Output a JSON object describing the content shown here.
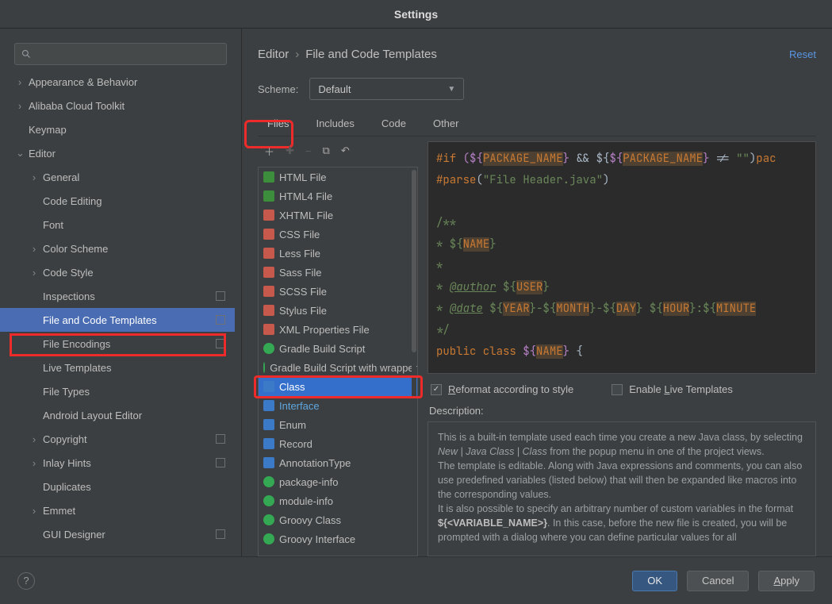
{
  "title": "Settings",
  "search_placeholder": "",
  "tree": [
    {
      "label": "Appearance & Behavior",
      "lvl": 1,
      "exp": true,
      "sel": false,
      "mod": false
    },
    {
      "label": "Alibaba Cloud Toolkit",
      "lvl": 1,
      "exp": true,
      "sel": false,
      "mod": false
    },
    {
      "label": "Keymap",
      "lvl": 1,
      "exp": null,
      "sel": false,
      "mod": false
    },
    {
      "label": "Editor",
      "lvl": 1,
      "exp": "open",
      "sel": false,
      "mod": false
    },
    {
      "label": "General",
      "lvl": 2,
      "exp": true,
      "sel": false,
      "mod": false
    },
    {
      "label": "Code Editing",
      "lvl": 2,
      "exp": null,
      "sel": false,
      "mod": false
    },
    {
      "label": "Font",
      "lvl": 2,
      "exp": null,
      "sel": false,
      "mod": false
    },
    {
      "label": "Color Scheme",
      "lvl": 2,
      "exp": true,
      "sel": false,
      "mod": false
    },
    {
      "label": "Code Style",
      "lvl": 2,
      "exp": true,
      "sel": false,
      "mod": false
    },
    {
      "label": "Inspections",
      "lvl": 2,
      "exp": null,
      "sel": false,
      "mod": true
    },
    {
      "label": "File and Code Templates",
      "lvl": 2,
      "exp": null,
      "sel": true,
      "mod": true
    },
    {
      "label": "File Encodings",
      "lvl": 2,
      "exp": null,
      "sel": false,
      "mod": true
    },
    {
      "label": "Live Templates",
      "lvl": 2,
      "exp": null,
      "sel": false,
      "mod": false
    },
    {
      "label": "File Types",
      "lvl": 2,
      "exp": null,
      "sel": false,
      "mod": false
    },
    {
      "label": "Android Layout Editor",
      "lvl": 2,
      "exp": null,
      "sel": false,
      "mod": false
    },
    {
      "label": "Copyright",
      "lvl": 2,
      "exp": true,
      "sel": false,
      "mod": true
    },
    {
      "label": "Inlay Hints",
      "lvl": 2,
      "exp": true,
      "sel": false,
      "mod": true
    },
    {
      "label": "Duplicates",
      "lvl": 2,
      "exp": null,
      "sel": false,
      "mod": false
    },
    {
      "label": "Emmet",
      "lvl": 2,
      "exp": true,
      "sel": false,
      "mod": false
    },
    {
      "label": "GUI Designer",
      "lvl": 2,
      "exp": null,
      "sel": false,
      "mod": true
    }
  ],
  "breadcrumb": {
    "a": "Editor",
    "sep": "›",
    "b": "File and Code Templates"
  },
  "reset": "Reset",
  "scheme_label": "Scheme:",
  "scheme_value": "Default",
  "tabs": [
    "Files",
    "Includes",
    "Code",
    "Other"
  ],
  "toolbar": {
    "add": "＋",
    "adddis": "✚",
    "minus": "−",
    "copy": "⧉",
    "undo": "↶"
  },
  "files": [
    {
      "label": "HTML File",
      "icon": "i-html"
    },
    {
      "label": "HTML4 File",
      "icon": "i-html"
    },
    {
      "label": "XHTML File",
      "icon": "i-red"
    },
    {
      "label": "CSS File",
      "icon": "i-red"
    },
    {
      "label": "Less File",
      "icon": "i-red"
    },
    {
      "label": "Sass File",
      "icon": "i-red"
    },
    {
      "label": "SCSS File",
      "icon": "i-red"
    },
    {
      "label": "Stylus File",
      "icon": "i-red"
    },
    {
      "label": "XML Properties File",
      "icon": "i-red"
    },
    {
      "label": "Gradle Build Script",
      "icon": "i-gr"
    },
    {
      "label": "Gradle Build Script with wrapper",
      "icon": "i-gr"
    },
    {
      "label": "Class",
      "icon": "i-blue",
      "sel": true
    },
    {
      "label": "Interface",
      "icon": "i-blue",
      "link": true
    },
    {
      "label": "Enum",
      "icon": "i-blue"
    },
    {
      "label": "Record",
      "icon": "i-blue"
    },
    {
      "label": "AnnotationType",
      "icon": "i-blue"
    },
    {
      "label": "package-info",
      "icon": "i-gr"
    },
    {
      "label": "module-info",
      "icon": "i-gr"
    },
    {
      "label": "Groovy Class",
      "icon": "i-gr"
    },
    {
      "label": "Groovy Interface",
      "icon": "i-gr"
    }
  ],
  "code": {
    "l1a": "#if ",
    "l1b": "(${",
    "l1c": "PACKAGE_NAME",
    "l1d": "}",
    " l1e": " && ${",
    "l1f": "PACKAGE_NAME",
    "l1g": "} != ",
    "l1h": "\"\"",
    "l1i": ")",
    "l1j": "pac",
    "l2a": "#parse",
    "l2b": "(",
    "l2c": "\"File Header.java\"",
    "l2d": ")",
    "c1": "/**",
    "c2": " * ${",
    "c2v": "NAME",
    "c2e": "}",
    "c3": " *",
    "c4": " * ",
    "c4u": "@author",
    "c4s": " ${",
    "c4v": "USER",
    "c4e": "}",
    "c5": " * ",
    "c5u": "@date",
    "c5s": " ${",
    "c5y": "YEAR",
    "c5d": "}-${",
    "c5m": "MONTH",
    "c5d2": "}-${",
    "c5da": "DAY",
    "c5e": "} ${",
    "c5h": "HOUR",
    "c5co": "}:${",
    "c5mi": "MINUTE",
    "c6": " */",
    "p1": "public class ",
    "p2": "${",
    "p2v": "NAME",
    "p2e": "}",
    " p3": " {"
  },
  "checks": {
    "reformat_pre": "R",
    "reformat": "eformat according to style",
    "live_pre": "Enable ",
    "live_u": "L",
    "live_post": "ive Templates"
  },
  "desc": {
    "label": "Description:",
    "t1": "This is a built-in template used each time you create a new Java class, by selecting ",
    "it": "New | Java Class | Class",
    "t2": " from the popup menu in one of the project views.",
    "t3": "The template is editable. Along with Java expressions and comments, you can also use predefined variables (listed below) that will then be expanded like macros into the corresponding values.",
    "t4": "It is also possible to specify an arbitrary number of custom variables in the format ",
    "bd": "${<VARIABLE_NAME>}",
    "t5": ". In this case, before the new file is created, you will be prompted with a dialog where you can define particular values for all"
  },
  "buttons": {
    "ok": "OK",
    "cancel": "Cancel",
    "apply_u": "A",
    "apply": "pply"
  }
}
